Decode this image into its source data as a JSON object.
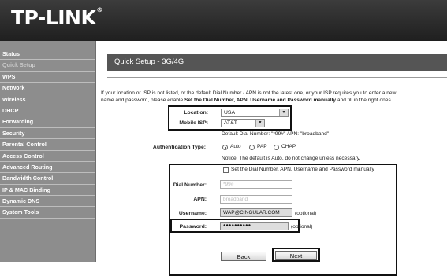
{
  "app": {
    "logo": "TP-LINK",
    "logo_mark": "®"
  },
  "sidebar": {
    "items": [
      {
        "label": "Status"
      },
      {
        "label": "Quick Setup",
        "active": true
      },
      {
        "label": "WPS"
      },
      {
        "label": "Network"
      },
      {
        "label": "Wireless"
      },
      {
        "label": "DHCP"
      },
      {
        "label": "Forwarding"
      },
      {
        "label": "Security"
      },
      {
        "label": "Parental Control"
      },
      {
        "label": "Access Control"
      },
      {
        "label": "Advanced Routing"
      },
      {
        "label": "Bandwidth Control"
      },
      {
        "label": "IP & MAC Binding"
      },
      {
        "label": "Dynamic DNS"
      },
      {
        "label": "System Tools"
      }
    ]
  },
  "page": {
    "title": "Quick Setup - 3G/4G",
    "intro_line1": "If your location or ISP is not listed, or the default Dial Number / APN is not the latest one, or your ISP requires you to enter a new",
    "intro_line2_pre": "name and password, please enable ",
    "intro_line2_bold": "Set the Dial Number, APN, Username and Password manually",
    "intro_line2_post": " and fill in the right ones."
  },
  "form": {
    "location_label": "Location:",
    "location_value": "USA",
    "isp_label": "Mobile ISP:",
    "isp_value": "AT&T",
    "default_dial_note": "Default Dial Number: \"*99#\"  APN: \"broadband\"",
    "auth_label": "Authentication Type:",
    "auth_options": [
      "Auto",
      "PAP",
      "CHAP"
    ],
    "auth_selected": "Auto",
    "auth_notice": "Notice: The default is Auto, do not change unless necessary.",
    "manual_checkbox_label": "Set the Dial Number, APN, Username and Password manually",
    "manual_checked": false,
    "dial_label": "Dial Number:",
    "dial_value": "*99#",
    "apn_label": "APN:",
    "apn_value": "broadband",
    "username_label": "Username:",
    "username_value": "WAP@CINGULAR.COM",
    "username_hint": "(optional)",
    "password_label": "Password:",
    "password_value": "●●●●●●●●●●",
    "password_hint": "(optional)"
  },
  "buttons": {
    "back": "Back",
    "next": "Next"
  },
  "colors": {
    "header": "#2b2b2b",
    "sidebar": "#8d8d8d",
    "banner": "#555555"
  }
}
